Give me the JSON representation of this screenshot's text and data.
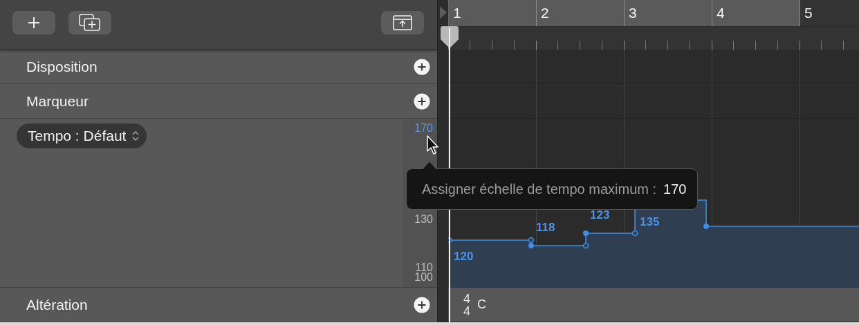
{
  "toolbar": {
    "buttons": [
      {
        "kind": "add"
      },
      {
        "kind": "add-window"
      },
      {
        "kind": "export"
      }
    ]
  },
  "ruler": {
    "bars": [
      {
        "label": "1",
        "in_cycle": true
      },
      {
        "label": "2",
        "in_cycle": true
      },
      {
        "label": "3",
        "in_cycle": true
      },
      {
        "label": "4",
        "in_cycle": true
      },
      {
        "label": "5",
        "in_cycle": false
      }
    ]
  },
  "tracks": [
    {
      "kind": "plain",
      "name": "Disposition"
    },
    {
      "kind": "plain",
      "name": "Marqueur"
    },
    {
      "kind": "tempo",
      "selector": "Tempo : Défaut",
      "scale": [
        {
          "label": "170",
          "highlighted": true
        },
        {
          "label": "130",
          "highlighted": false
        },
        {
          "label": "110",
          "highlighted": false
        },
        {
          "label": "100",
          "highlighted": false
        }
      ],
      "events": [
        {
          "label": "120"
        },
        {
          "label": "118"
        },
        {
          "label": "123"
        },
        {
          "label": "135"
        }
      ]
    },
    {
      "kind": "signature",
      "name": "Altération",
      "numerator": "4",
      "denominator": "4",
      "key": "C"
    }
  ],
  "tooltip": {
    "label": "Assigner échelle de tempo maximum :",
    "value": "170"
  }
}
